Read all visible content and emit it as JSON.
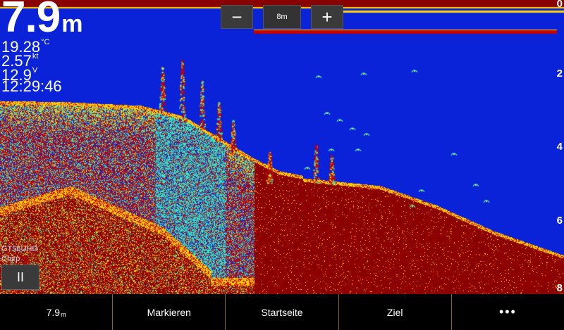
{
  "readout": {
    "depth_value": "7.9",
    "depth_unit": "m",
    "temperature": "19.28",
    "temperature_unit": "°C",
    "speed": "2.57",
    "speed_unit": "kt",
    "voltage": "12.9",
    "voltage_unit": "V",
    "time": "12:29:46"
  },
  "zoom": {
    "minus_label": "−",
    "range_label": "8m",
    "plus_label": "+"
  },
  "depth_scale": [
    "0",
    "2",
    "4",
    "6",
    "8"
  ],
  "transducer": {
    "name": "GT56UHD",
    "mode": "Chirp"
  },
  "pause_label": "II",
  "bottom_bar": {
    "depth_value": "7.9",
    "depth_unit": "m",
    "mark": "Markieren",
    "home": "Startseite",
    "target": "Ziel",
    "more": "•••"
  },
  "colors": {
    "water": "#0a23d8",
    "bottom": "#8a0000",
    "strong": "#c40000",
    "medium": "#ffd400",
    "weak": "#33e6c8",
    "accent_divider": "#8a6a1a"
  }
}
